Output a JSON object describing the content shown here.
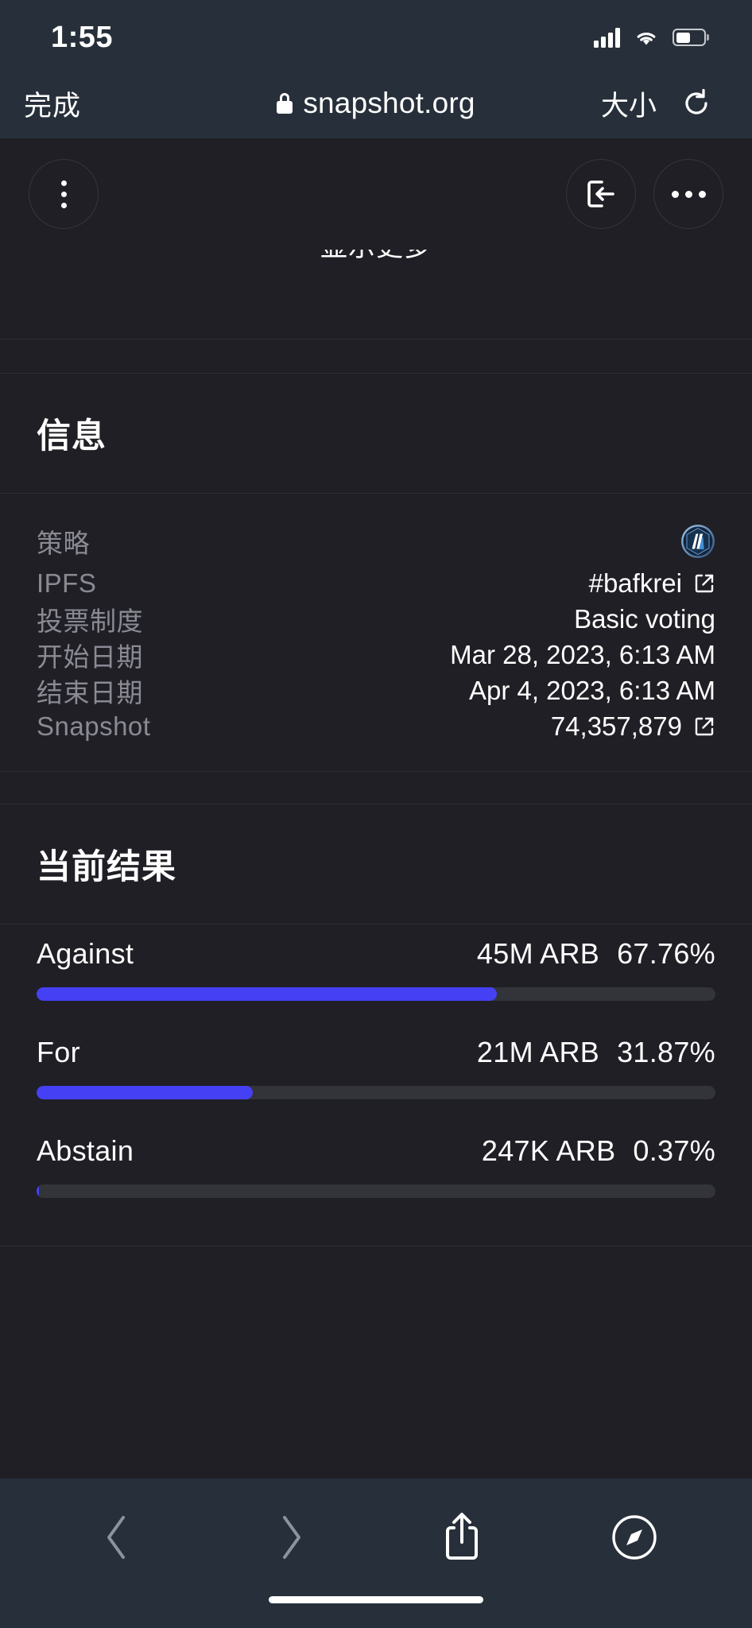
{
  "statusbar": {
    "time": "1:55",
    "signal_icon": "cellular-signal-icon",
    "wifi_icon": "wifi-icon",
    "battery_icon": "battery-icon"
  },
  "browser": {
    "done_label": "完成",
    "lock_icon": "lock-icon",
    "host": "snapshot.org",
    "size_label": "大小",
    "reload_icon": "reload-icon",
    "bottom": {
      "back_icon": "chevron-left-icon",
      "forward_icon": "chevron-right-icon",
      "share_icon": "share-icon",
      "compass_icon": "compass-icon"
    }
  },
  "app_topbar": {
    "menu_icon": "kebab-menu-icon",
    "exit_icon": "exit-arrow-icon",
    "more_icon": "more-horizontal-icon"
  },
  "truncated_text": "显示更多",
  "info_section": {
    "title": "信息",
    "rows": [
      {
        "label": "策略",
        "value": "",
        "icon": "arbitrum-logo-icon"
      },
      {
        "label": "IPFS",
        "value": "#bafkrei",
        "icon": "external-link-icon"
      },
      {
        "label": "投票制度",
        "value": "Basic voting",
        "icon": ""
      },
      {
        "label": "开始日期",
        "value": "Mar 28, 2023, 6:13 AM",
        "icon": ""
      },
      {
        "label": "结束日期",
        "value": "Apr 4, 2023, 6:13 AM",
        "icon": ""
      },
      {
        "label": "Snapshot",
        "value": "74,357,879",
        "icon": "external-link-icon"
      }
    ]
  },
  "results_section": {
    "title": "当前结果",
    "accent_color": "#4640f5",
    "track_color": "#33333a"
  },
  "chart_data": {
    "type": "bar",
    "title": "当前结果",
    "categories": [
      "Against",
      "For",
      "Abstain"
    ],
    "values": [
      67.76,
      31.87,
      0.37
    ],
    "amount_labels": [
      "45M ARB",
      "21M ARB",
      "247K ARB"
    ],
    "percent_labels": [
      "67.76%",
      "31.87%",
      "0.37%"
    ],
    "unit": "ARB",
    "xlabel": "",
    "ylabel": "",
    "ylim": [
      0,
      100
    ],
    "orientation": "horizontal",
    "grid": false,
    "legend": "none"
  }
}
